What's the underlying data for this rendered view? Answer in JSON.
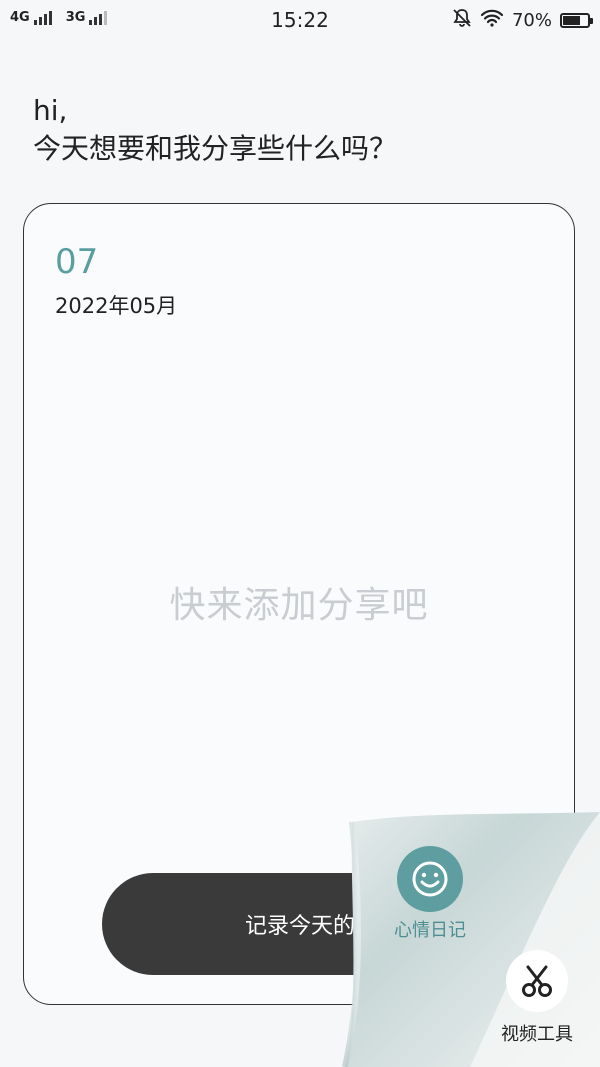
{
  "status_bar": {
    "network1": "4G",
    "network2": "3G",
    "time": "15:22",
    "battery_text": "70%",
    "battery_level": 0.7
  },
  "greeting": {
    "line1": "hi,",
    "line2": "今天想要和我分享些什么吗？"
  },
  "card": {
    "day": "07",
    "year_month": "2022年05月",
    "empty_text": "快来添加分享吧",
    "record_button": "记录今天的故事"
  },
  "tools": {
    "mood_label": "心情日记",
    "video_label": "视频工具"
  },
  "colors": {
    "accent": "#5e9ea0",
    "button_dark": "#3a3a3a"
  }
}
